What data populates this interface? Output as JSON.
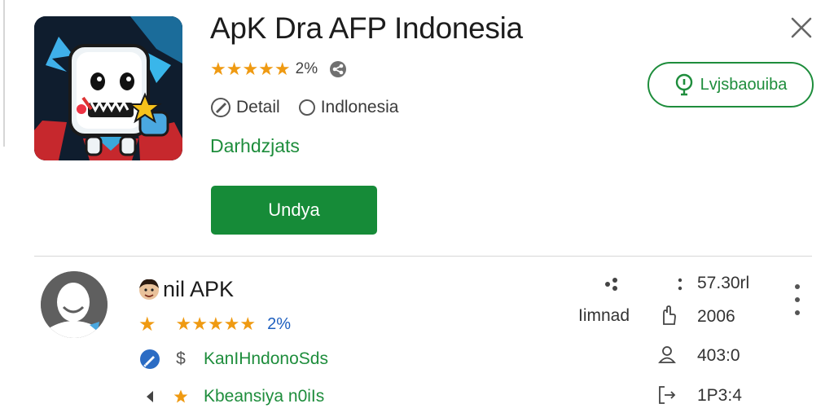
{
  "app": {
    "title": "ApK Dra AFP Indonesia",
    "stars": "★★★★★",
    "rating_text": "2%",
    "detail_label": "Detail",
    "region_label": "Indlonesia",
    "developer_link": "Darhdzjats",
    "install_label": "Undya",
    "wishlist_label": "Lvjsbaouiba"
  },
  "list_item": {
    "title": "nil APK",
    "stars": "★★★★★",
    "rating_text": "2%",
    "row1_symbol": "$",
    "row1_text": "KanIHndonoSds",
    "row2_text": "Kbeansiya n0iIs",
    "meta": {
      "value_top": "57.30rl",
      "label_mid": "Iimnad",
      "value_mid": "2006",
      "value_3": "403:0",
      "value_4": "1P3:4"
    }
  },
  "icons": {
    "close": "close-icon",
    "share": "share-icon",
    "detail": "detail-icon",
    "wishlist": "alert-icon",
    "more": "more-vertical-icon"
  },
  "colors": {
    "accent_green": "#1e8d3c",
    "install_green": "#168b38",
    "star_orange": "#ef9a12",
    "link_blue": "#1e5fbf"
  }
}
